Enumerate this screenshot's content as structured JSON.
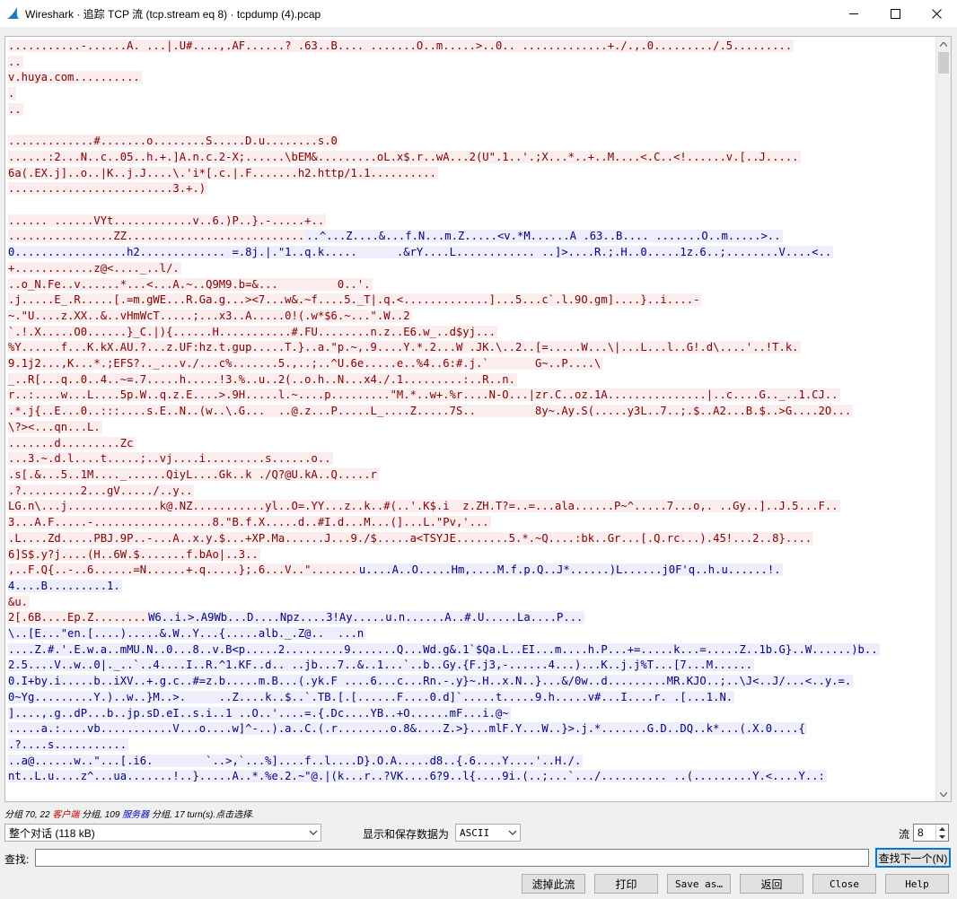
{
  "window": {
    "title": "Wireshark · 追踪 TCP 流 (tcp.stream eq 8) · tcpdump (4).pcap",
    "minimize_label": "minimize",
    "maximize_label": "maximize",
    "close_label": "close"
  },
  "stream": {
    "lines": [
      {
        "dir": "c",
        "text": "...........-......A. ...|.U#....,.AF......? .63..B.... .......O..m.....>..0.. .............+./.,.0........./.5........."
      },
      {
        "dir": "c",
        "text": ".."
      },
      {
        "dir": "c",
        "text": "v.huya.com.........."
      },
      {
        "dir": "c",
        "text": "."
      },
      {
        "dir": "c",
        "text": ".."
      },
      {
        "dir": "blank",
        "text": ""
      },
      {
        "dir": "c",
        "text": ".............#.......o........S.....D.u........s.0"
      },
      {
        "dir": "c",
        "text": "......:2...N..c..05..h.+.]A.n.c.2-X;......\\bEM&.........oL.x$.r..wA...2(U\".1..'.;X...*..+..M....<.C..<!......v.[..J....."
      },
      {
        "dir": "c",
        "text": "6a(.EX.j]..o..|K..j.J....\\.'i*[.c.|.F.......h2.http/1.1.........."
      },
      {
        "dir": "c",
        "text": ".........................3.+.)"
      },
      {
        "dir": "blank",
        "text": ""
      },
      {
        "dir": "c",
        "text": "...... ......VYt............v..6.)P..}.-.....+.."
      },
      {
        "dir": "mix",
        "c": "................ZZ...........................",
        "s": "..^...Z....&...f.N...m.Z.....<v.*M......A .63..B.... .......O..m.....>.."
      },
      {
        "dir": "s",
        "text": "0.................h2............. =.8j.|.\"1..q.k.....      .&rY....L............ ..]>....R.;.H..0.....1z.6..;........V....<.."
      },
      {
        "dir": "c",
        "text": "+............z@<...._..l/."
      },
      {
        "dir": "c",
        "text": "..o_N.Fe..v......*...<...A.~..Q9M9.b=&...         0..'."
      },
      {
        "dir": "c",
        "text": ".j.....E_.R.....[.=m.gWE...R.Ga.g...><7...w&.~f....5._T|.q.<.............]...5...c`.l.9O.gm]....}..i....-"
      },
      {
        "dir": "c",
        "text": "~.\"U....z.XX..&..vHmWcT.....;...x3..A.....0!(.w*$6.~...\".W..2"
      },
      {
        "dir": "c",
        "text": "`.!.X.....O0......}_C.|){......H...........#.FU........n.z..E6.w_..d$yj..."
      },
      {
        "dir": "c",
        "text": "%Y......f...K.kX.AU.?...z.UF:hz.t.gup.....T.}..a.\"p.~,.9....Y.*.2...W .JK.\\..2..[=.....W...\\|...L...l..G!.d\\....'..!T.k."
      },
      {
        "dir": "c",
        "text": "9.1j2...,K...*.;EFS?.._...v./...c%.......5.,..;..^U.6e.....e..%4..6:#.j.`       G~..P....\\"
      },
      {
        "dir": "c",
        "text": "_..R[...q..0..4..~=.7.....h.....!3.%..u..2(..o.h..N...x4./.1.........:..R..n."
      },
      {
        "dir": "c",
        "text": "r..:....w...L....5p.W..q.z.E....>.9H.....l.~....p.........\"M.*..w+.%r....N-O...|zr.C..oz.1A...............|..c....G.._..1.CJ.."
      },
      {
        "dir": "c",
        "text": ".*.j{..E...0..:::....s.E..N..(w..\\.G...  ..@.z...P.....L_....Z.....7S..         8y~.Ay.S(.....y3L..7..;.$..A2...B.$..>G....2O..."
      },
      {
        "dir": "c",
        "text": "\\?><...qn...L."
      },
      {
        "dir": "c",
        "text": ".......d.........Zc"
      },
      {
        "dir": "c",
        "text": "...3.~.d.l....t.....;..vj....i.........s......o.."
      },
      {
        "dir": "c",
        "text": ".s[.&...5..1M...._......QiyL....Gk..k ./Q?@U.kA..Q.....r"
      },
      {
        "dir": "c",
        "text": ".?.........2...gV...../..y.."
      },
      {
        "dir": "c",
        "text": "LG.n\\...j..............k@.NZ...........yl..O=.YY...z..k..#(..'.K$.i  z.ZH.T?=..=...ala......P~^.....7...o,. ..Gy..]..J.5...F.."
      },
      {
        "dir": "c",
        "text": "3...A.F.....-..................8.\"B.f.X.....d..#I.d...M...(]...L.\"Pv,'..."
      },
      {
        "dir": "c",
        "text": ".L....Zd.....PBJ.9P..-...A..x.y.$...+XP.Ma......J...9./$.....a<TSYJE........5.*.~Q....:bk..Gr...[.Q.rc...).45!...2..8}...."
      },
      {
        "dir": "c",
        "text": "6]S$.y?j....(H..6W.$.......f.bAo|..3.."
      },
      {
        "dir": "mix",
        "c": ",..F.Q{..-..6......=N......+.q.....};.6...V..\".......",
        "s": "u....A..O.....Hm,....M.f.p.Q..J*......)L......j0F'q..h.u......!."
      },
      {
        "dir": "s",
        "text": "4....B.........1."
      },
      {
        "dir": "c",
        "text": "&u."
      },
      {
        "dir": "mix",
        "c": "2[.6B....Ep.Z........",
        "s": "W6..i.>.A9Wb...D....Npz....3!Ay.....u.n......A..#.U.....La....P..."
      },
      {
        "dir": "s",
        "text": "\\..[E...\"en.[....).....&.W..Y...{.....alb._.Z@..  ...n"
      },
      {
        "dir": "s",
        "text": "....Z.#.'.E.w.a..mMU.N..0...8..v.B<p.....2.........9.......Q...Wd.g&.1`$Qa.L..EI...m....h.P...+=.....k...=.....Z..1b.G}..W......)b.."
      },
      {
        "dir": "s",
        "text": "2.5....V..w..0|._..`..4....I..R.^1.KF..d.. ..jb...7..&..1...`..b..Gy.{F.j3,-......4...)...K..j.j%T...[7...M......"
      },
      {
        "dir": "s",
        "text": "0.I+by.i.....b..iXV..+.g.c..#=z.b.....m.B...(.yk.F ....6...c...Rn.-.y}~.H..x.N..}...&/0w..d.........MR.KJO..;..\\J<..J/...<..y.=."
      },
      {
        "dir": "s",
        "text": "0~Yg.........Y.)..w..}M..>.     ..Z....k..$..`.TB.[.[......F....0.d]`.....t.....9.h.....v#...I....r. .[...1.N."
      },
      {
        "dir": "s",
        "text": "]....,.g..dP...b..jp.sD.eI..s.i..1 ..O..'....=.{.Dc....YB..+O......mF...i.@~"
      },
      {
        "dir": "s",
        "text": ".....a.:....vb...........V...o....w]^-..).a..C.(.r........o.8&....Z.>}...mlF.Y...W..}>.j.*.......G.D..DQ..k*...(.X.0....{"
      },
      {
        "dir": "s",
        "text": ".?....s..........."
      },
      {
        "dir": "s",
        "text": "..a@......w..\"...[.i6.        `..>,`...%]....f..l....D}.O.A.....d8..{.6....Y....'..H./."
      },
      {
        "dir": "s",
        "text": "nt..L.u....z^...ua.......!..}.....A..*.%e.2.~\"@.|(k...r..?VK....6?9..l{....9i.(..;...`.../.......... ..(.........Y.<....Y..:"
      }
    ]
  },
  "status": {
    "prefix": "分组 70, 22 ",
    "client_label": "客户端",
    "mid": " 分组, 109 ",
    "server_label": "服务器",
    "suffix": " 分组, 17 turn(s).点击选择."
  },
  "controls": {
    "conversation_value": "整个对话 (118 kB)",
    "show_save_label": "显示和保存数据为",
    "format_value": "ASCII",
    "stream_label": "流",
    "stream_value": "8",
    "find_label": "查找:",
    "find_value": "",
    "find_next_label": "查找下一个(N)"
  },
  "buttons": {
    "filter_out": "滤掉此流",
    "print": "打印",
    "save_as": "Save as…",
    "back": "返回",
    "close": "Close",
    "help": "Help"
  },
  "colors": {
    "client_bg": "#fbeded",
    "client_fg": "#800000",
    "server_bg": "#ededfb",
    "server_fg": "#000080"
  }
}
